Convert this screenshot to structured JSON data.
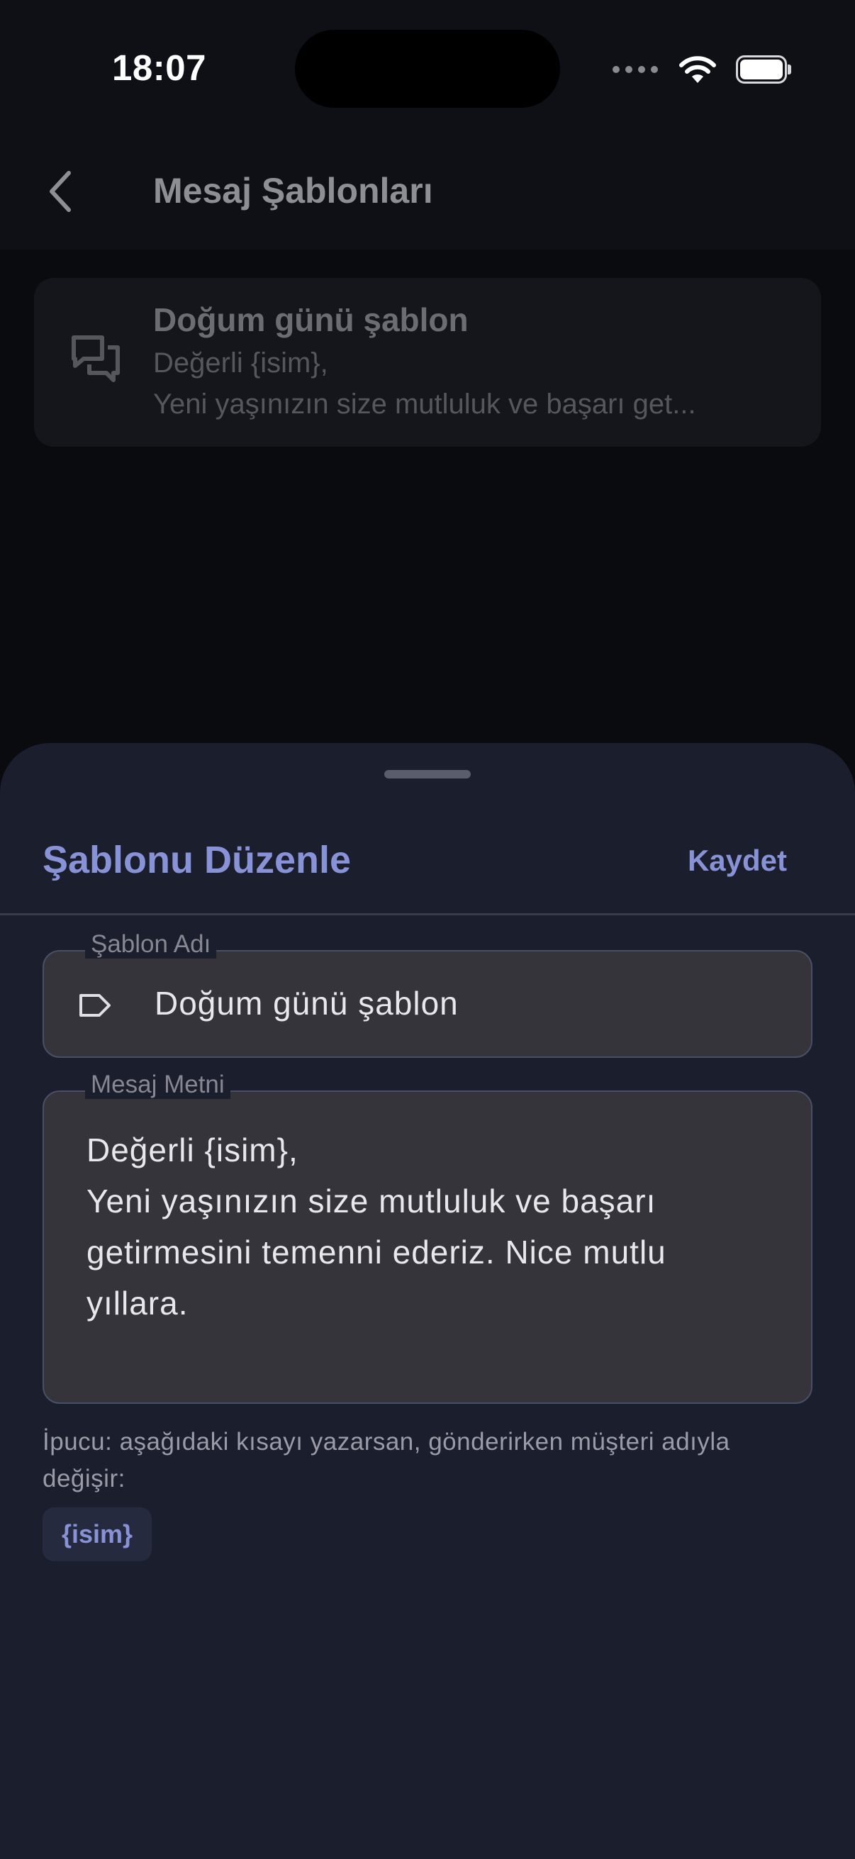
{
  "status_bar": {
    "time": "18:07"
  },
  "nav": {
    "title": "Mesaj Şablonları",
    "back_icon": "chevron-left-icon"
  },
  "template_list": [
    {
      "title": "Doğum günü şablon",
      "preview_line1": "Değerli {isim},",
      "preview_line2": "Yeni yaşınızın size mutluluk ve başarı get...",
      "icon": "chat-bubbles-icon"
    }
  ],
  "sheet": {
    "title": "Şablonu Düzenle",
    "save_label": "Kaydet",
    "name_field": {
      "label": "Şablon Adı",
      "value": "Doğum günü şablon",
      "icon": "tag-icon"
    },
    "message_field": {
      "label": "Mesaj Metni",
      "value": "Değerli {isim},\nYeni yaşınızın size mutluluk ve başarı\ngetirmesini temenni ederiz. Nice mutlu\nyıllara."
    },
    "hint": "İpucu: aşağıdaki kısayı yazarsan, gönderirken müşteri adıyla değişir:",
    "shortcut_chip": "{isim}"
  },
  "colors": {
    "accent": "#8793d6",
    "sheet_background": "#1b1e2c",
    "field_background": "#34343a"
  }
}
